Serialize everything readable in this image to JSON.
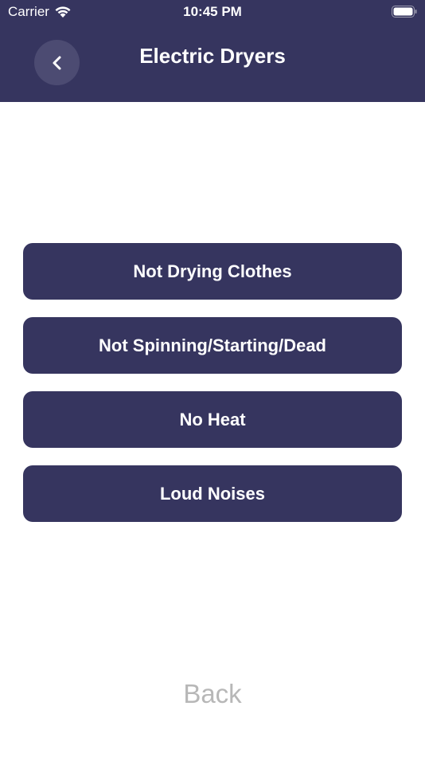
{
  "status_bar": {
    "carrier": "Carrier",
    "time": "10:45 PM"
  },
  "nav": {
    "title": "Electric Dryers",
    "back_icon": "chevron-left-icon"
  },
  "options": [
    {
      "label": "Not Drying Clothes"
    },
    {
      "label": "Not Spinning/Starting/Dead"
    },
    {
      "label": "No Heat"
    },
    {
      "label": "Loud Noises"
    }
  ],
  "footer": {
    "back_label": "Back"
  },
  "colors": {
    "primary": "#36355f",
    "back_circle": "#4c4b72",
    "back_text": "#b7b7b7",
    "background": "#ffffff"
  }
}
